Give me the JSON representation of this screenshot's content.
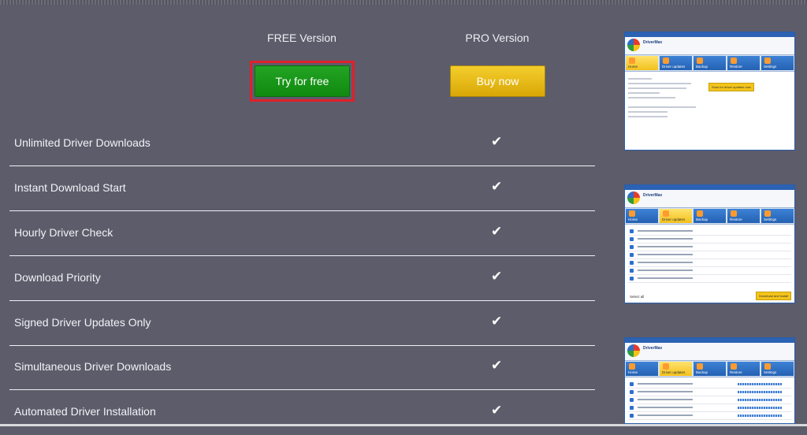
{
  "versions": {
    "free_title": "FREE Version",
    "pro_title": "PRO Version",
    "free_button": "Try for free",
    "pro_button": "Buy now"
  },
  "features": [
    {
      "label": "Unlimited Driver Downloads",
      "pro": true
    },
    {
      "label": "Instant Download Start",
      "pro": true
    },
    {
      "label": "Hourly Driver Check",
      "pro": true
    },
    {
      "label": "Download Priority",
      "pro": true
    },
    {
      "label": "Signed Driver Updates Only",
      "pro": true
    },
    {
      "label": "Simultaneous Driver Downloads",
      "pro": true
    },
    {
      "label": "Automated Driver Installation",
      "pro": true
    }
  ],
  "check_glyph": "✔",
  "colors": {
    "background": "#5d5c6b",
    "free_button": "#16951a",
    "pro_button": "#efc11e",
    "highlight": "#e0202a"
  },
  "screenshots": [
    {
      "app": "DriverMax",
      "active_tab": "Home"
    },
    {
      "app": "DriverMax",
      "active_tab": "Driver updates"
    },
    {
      "app": "DriverMax",
      "active_tab": "Driver updates"
    }
  ],
  "shot_tabs": [
    "Home",
    "Driver updates",
    "Backup",
    "Restore",
    "Settings"
  ],
  "shot_labels": {
    "select_all": "Select all",
    "scan_button": "Scan for driver updates now",
    "download_install": "Download and install"
  }
}
